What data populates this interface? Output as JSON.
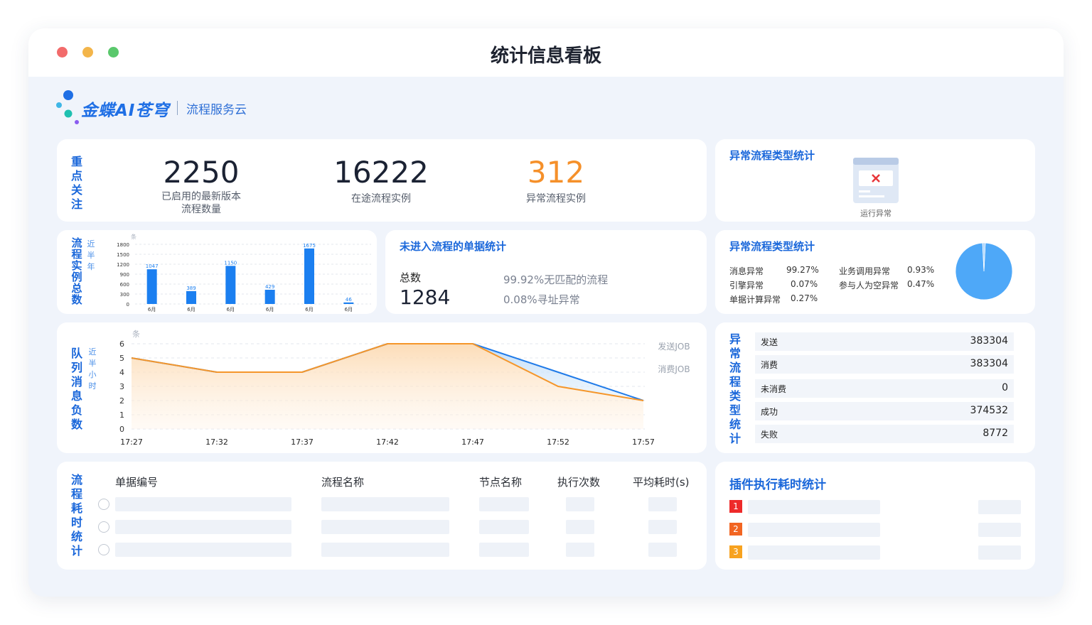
{
  "window": {
    "title": "统计信息看板",
    "dots": [
      "#f26b6b",
      "#f3b54a",
      "#5ac86c"
    ]
  },
  "brand": {
    "name": "金蝶AI苍穹",
    "product": "流程服务云"
  },
  "focus": {
    "title": "重点关注",
    "stats": [
      {
        "value": "2250",
        "label_line1": "已启用的最新版本",
        "label_line2": "流程数量",
        "color": "#1b2233"
      },
      {
        "value": "16222",
        "label_line1": "在途流程实例",
        "label_line2": "",
        "color": "#1b2233"
      },
      {
        "value": "312",
        "label_line1": "异常流程实例",
        "label_line2": "",
        "color": "#f5902a"
      }
    ]
  },
  "abnormal_top": {
    "title": "异常流程类型统计",
    "icon_label": "运行异常"
  },
  "instances": {
    "title": "流程实例总数",
    "subtitle": "近半年",
    "unit": "条",
    "chart_data": {
      "type": "bar",
      "categories": [
        "6月",
        "6月",
        "6月",
        "6月",
        "6月",
        "6月"
      ],
      "values": [
        1047,
        389,
        1150,
        429,
        1675,
        46
      ],
      "yticks": [
        0,
        300,
        600,
        900,
        1200,
        1500,
        1800
      ],
      "ylim": [
        0,
        1800
      ],
      "color": "#1b7ff0"
    }
  },
  "unprocessed": {
    "title": "未进入流程的单据统计",
    "total_label": "总数",
    "total_value": "1284",
    "line1": "99.92%无匹配的流程",
    "line2": "0.08%寻址异常"
  },
  "abnormal_pie": {
    "title": "异常流程类型统计",
    "items": [
      {
        "label": "消息异常",
        "value": "99.27%"
      },
      {
        "label": "业务调用异常",
        "value": "0.93%"
      },
      {
        "label": "引擎异常",
        "value": "0.07%"
      },
      {
        "label": "参与人为空异常",
        "value": "0.47%"
      },
      {
        "label": "单据计算异常",
        "value": "0.27%"
      }
    ],
    "chart_data": {
      "type": "pie",
      "values": [
        98.5,
        1.5
      ],
      "colors": [
        "#4ea8f8",
        "#a9d3fb"
      ]
    }
  },
  "queue": {
    "title": "队列消息负数",
    "subtitle": "近半小时",
    "unit": "条",
    "chart_data": {
      "type": "area",
      "x": [
        "17:27",
        "17:32",
        "17:37",
        "17:42",
        "17:47",
        "17:52",
        "17:57"
      ],
      "yticks": [
        0,
        1,
        2,
        3,
        4,
        5,
        6
      ],
      "ylim": [
        0,
        6
      ],
      "series": [
        {
          "name": "发送JOB",
          "values": [
            5,
            4,
            4,
            6,
            6,
            4,
            2
          ],
          "color": "#1f7ae8"
        },
        {
          "name": "消费JOB",
          "values": [
            5,
            4,
            4,
            6,
            6,
            3,
            2
          ],
          "color": "#f5962a"
        }
      ]
    }
  },
  "queue_table": {
    "title": "异常流程类型统计",
    "rows": [
      {
        "label": "发送",
        "value": "383304"
      },
      {
        "label": "消费",
        "value": "383304"
      },
      {
        "label": "未消费",
        "value": "0"
      },
      {
        "label": "成功",
        "value": "374532"
      },
      {
        "label": "失败",
        "value": "8772"
      }
    ]
  },
  "duration": {
    "title": "流程耗时统计",
    "headers": [
      "单据编号",
      "流程名称",
      "节点名称",
      "执行次数",
      "平均耗时(s)"
    ]
  },
  "plugin": {
    "title": "插件执行耗时统计",
    "ranks": [
      {
        "n": "1",
        "color": "#ee2a2a"
      },
      {
        "n": "2",
        "color": "#f26522"
      },
      {
        "n": "3",
        "color": "#f7a21f"
      }
    ]
  }
}
